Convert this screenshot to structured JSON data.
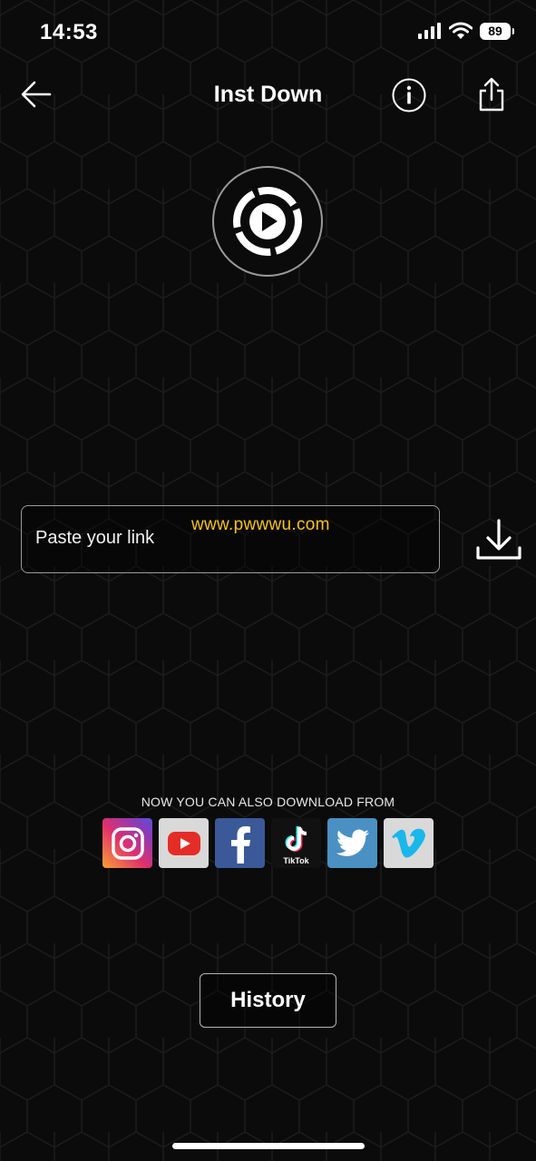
{
  "status_bar": {
    "time": "14:53",
    "battery": "89"
  },
  "nav": {
    "title": "Inst Down",
    "icons": [
      "back-arrow-icon",
      "info-icon",
      "share-icon"
    ]
  },
  "input": {
    "placeholder": "Paste your link",
    "watermark": "www.pwwwu.com"
  },
  "sources": {
    "title": "NOW YOU CAN ALSO DOWNLOAD FROM",
    "items": [
      "Instagram",
      "YouTube",
      "Facebook",
      "TikTok",
      "Twitter",
      "Vimeo"
    ],
    "tiktok_label": "TikTok"
  },
  "history_button": "History",
  "colors": {
    "background": "#0b0b0b",
    "watermark": "#f5c518",
    "border": "#9b9b9b"
  }
}
